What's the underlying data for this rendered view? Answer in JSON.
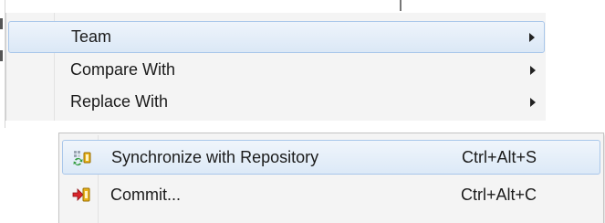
{
  "context_menu": {
    "items": [
      {
        "label": "Team",
        "has_submenu": true,
        "state": "hover"
      },
      {
        "label": "Compare With",
        "has_submenu": true
      },
      {
        "label": "Replace With",
        "has_submenu": true
      }
    ]
  },
  "team_submenu": {
    "items": [
      {
        "label": "Synchronize with Repository",
        "shortcut": "Ctrl+Alt+S",
        "icon": "synchronize-icon",
        "state": "hover"
      },
      {
        "label": "Commit...",
        "shortcut": "Ctrl+Alt+C",
        "icon": "commit-icon"
      }
    ]
  },
  "colors": {
    "menu_background": "#f4f4f4",
    "hover_border": "#a9c7ea",
    "hover_fill": "#dbe8f6"
  }
}
